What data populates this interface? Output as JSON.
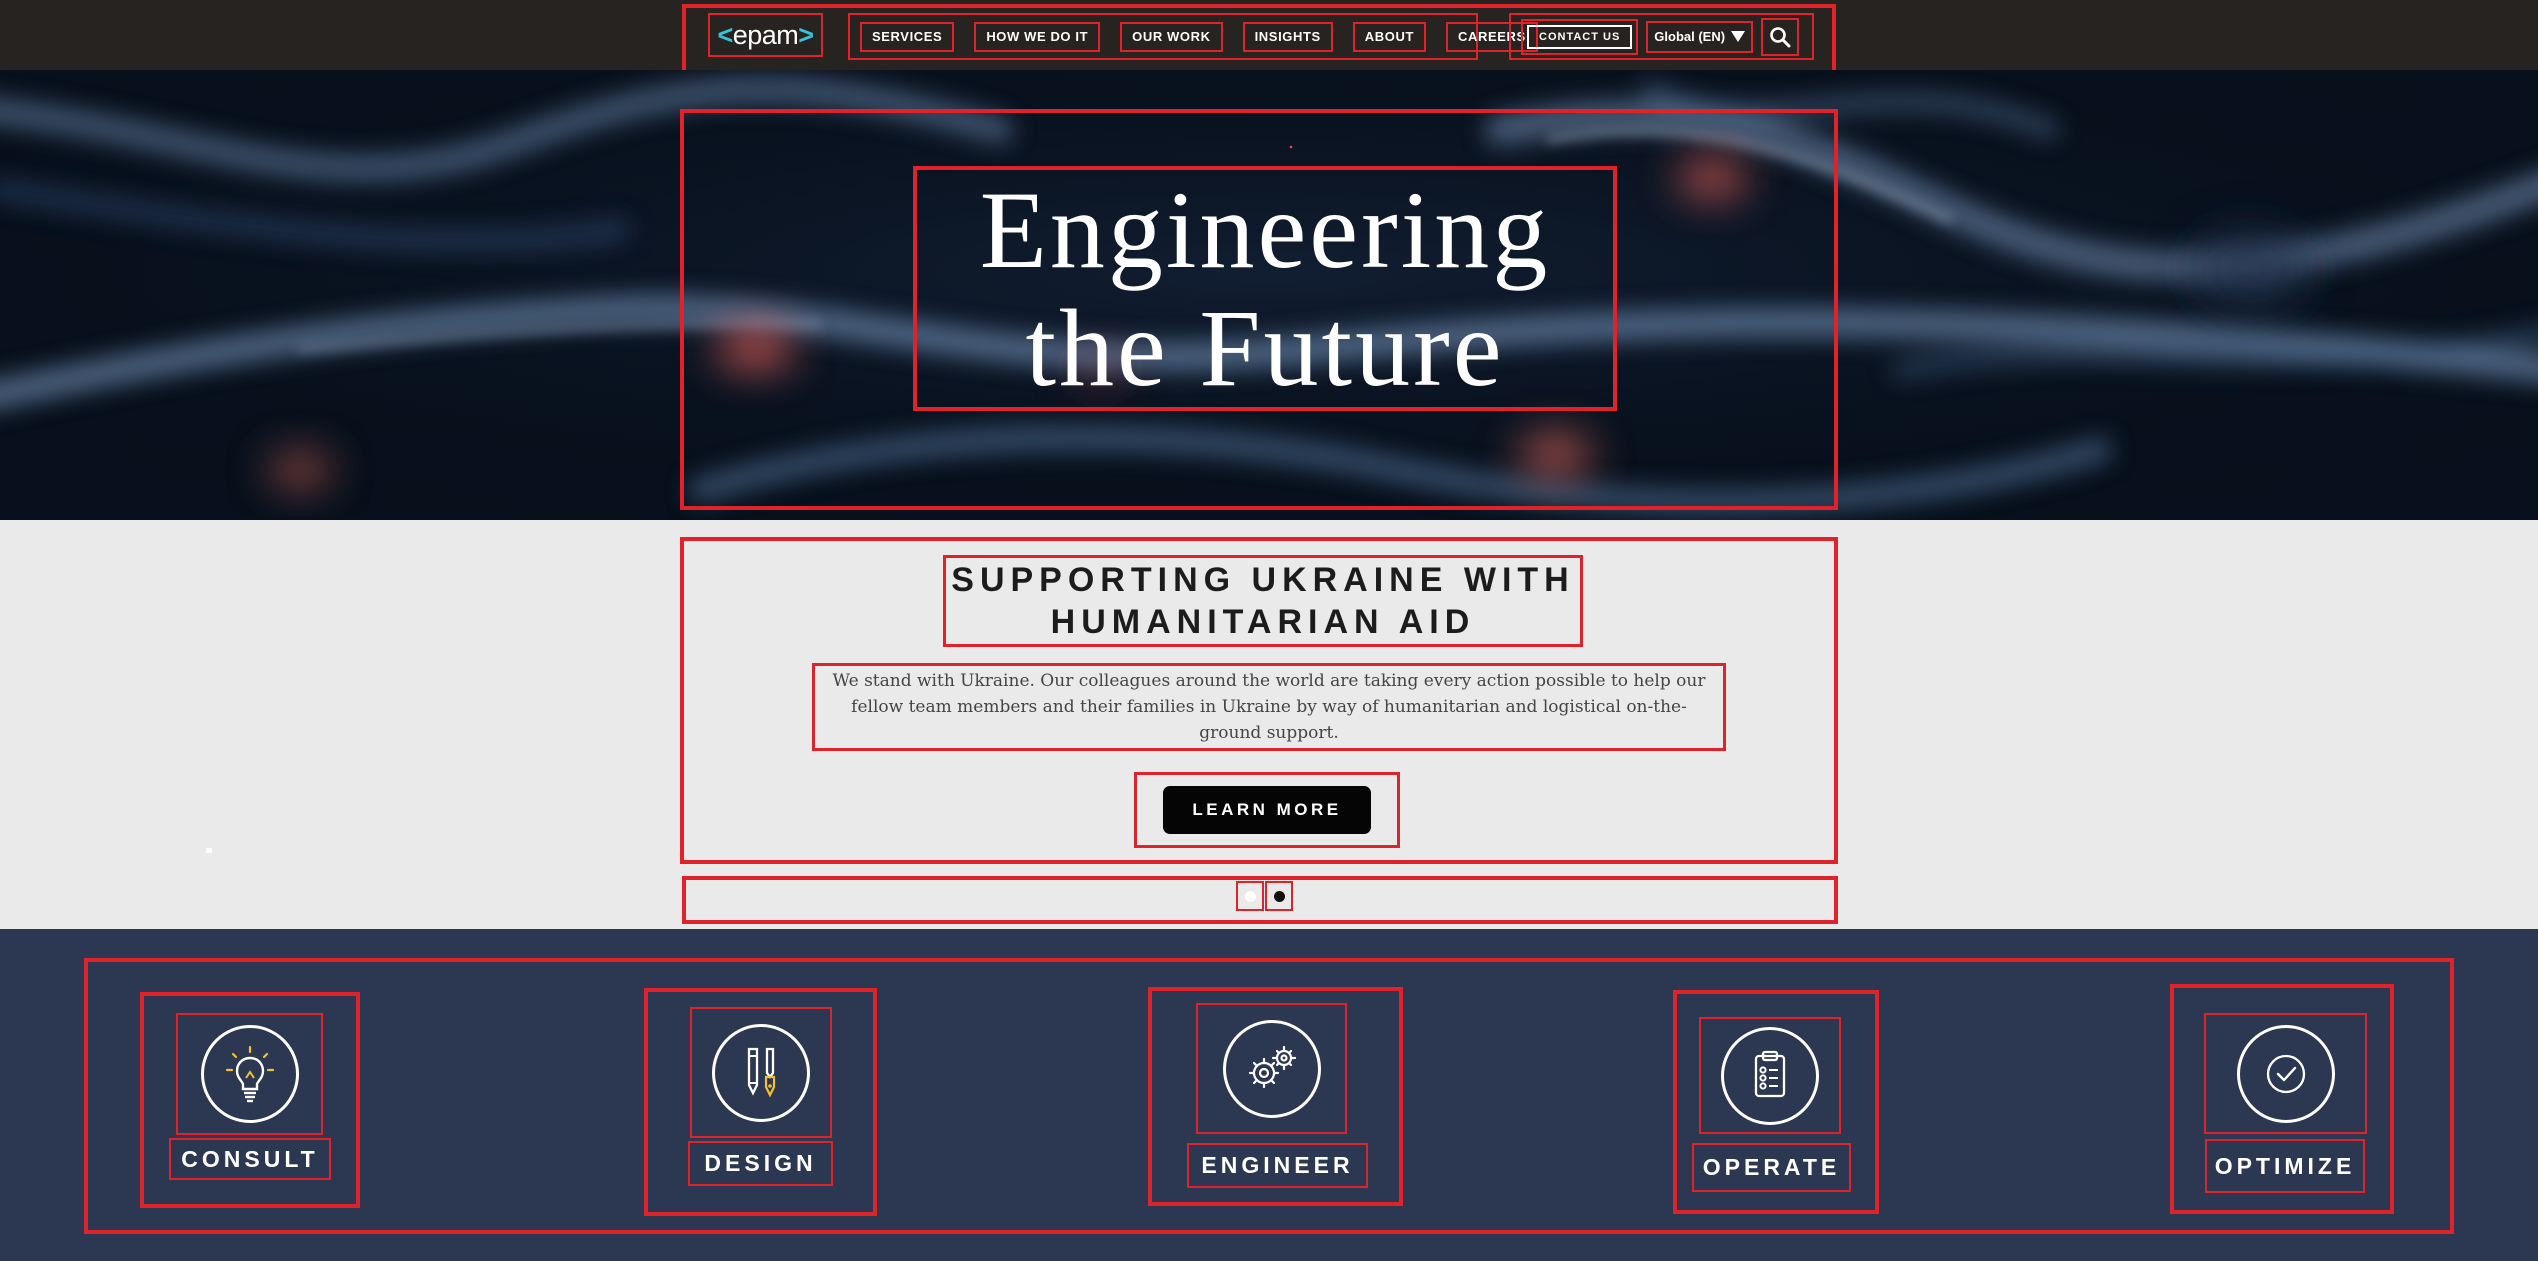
{
  "header": {
    "logo_text": "epam",
    "nav": [
      "SERVICES",
      "HOW WE DO IT",
      "OUR WORK",
      "INSIGHTS",
      "ABOUT",
      "CAREERS"
    ],
    "contact_label": "CONTACT US",
    "language": "Global (EN)",
    "search_icon": "search-icon"
  },
  "hero": {
    "title_line1": "Engineering",
    "title_line2": "the Future"
  },
  "ukraine": {
    "title_line1": "SUPPORTING UKRAINE WITH",
    "title_line2": "HUMANITARIAN AID",
    "text": "We stand with Ukraine. Our colleagues around the world are taking every action possible to help our fellow team members and their families in Ukraine by way of humanitarian and logistical on-the-ground support.",
    "button": "LEARN MORE"
  },
  "carousel": {
    "slides": 2,
    "active": 2
  },
  "services": [
    {
      "label": "CONSULT",
      "icon": "lightbulb-icon"
    },
    {
      "label": "DESIGN",
      "icon": "pencil-pen-icon"
    },
    {
      "label": "ENGINEER",
      "icon": "gears-icon"
    },
    {
      "label": "OPERATE",
      "icon": "clipboard-icon"
    },
    {
      "label": "OPTIMIZE",
      "icon": "checkmark-icon"
    }
  ],
  "colors": {
    "topbar": "#262321",
    "accent_cyan": "#39c2d7",
    "services_band": "#2c3752",
    "annotation_red": "#e0222b",
    "icon_yellow": "#f2c230"
  }
}
